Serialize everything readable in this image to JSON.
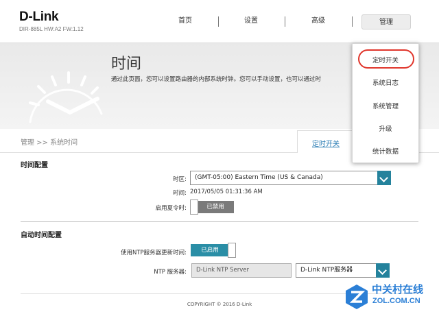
{
  "header": {
    "logo": "D-Link",
    "model": "DIR-885L HW:A2 FW:1.12",
    "nav": [
      {
        "label": "首页"
      },
      {
        "label": "设置"
      },
      {
        "label": "高级"
      },
      {
        "label": "管理"
      }
    ]
  },
  "banner": {
    "title": "时间",
    "description": "通过此页面，您可以设置路由器的内部系统时钟。您可以手动设置，也可以通过时"
  },
  "breadcrumb": "管理 >> 系统时间",
  "tab_link": "定时开关",
  "time_config": {
    "title": "时间配置",
    "timezone_label": "时区:",
    "timezone_value": "(GMT-05:00) Eastern Time (US & Canada)",
    "time_label": "时间:",
    "time_value": "2017/05/05 01:31:36 AM",
    "dst_label": "启用夏令时:",
    "dst_state": "已禁用"
  },
  "auto_time": {
    "title": "自动时间配置",
    "ntp_update_label": "使用NTP服务器更新时间:",
    "ntp_update_state": "已启用",
    "ntp_server_label": "NTP 服务器:",
    "ntp_server_value": "D-Link NTP Server",
    "ntp_server_select": "D-Link NTP服务器"
  },
  "footer": "COPYRIGHT © 2016 D-Link",
  "dropdown": {
    "items": [
      {
        "label": "定时开关"
      },
      {
        "label": "系统日志"
      },
      {
        "label": "系统管理"
      },
      {
        "label": "升级"
      },
      {
        "label": "统计数据"
      }
    ]
  },
  "watermark": {
    "line1": "中关村在线",
    "line2": "ZOL.COM.CN"
  },
  "colors": {
    "accent": "#24829c",
    "enabled": "#2a8ea6",
    "disabled": "#7a7a7a",
    "link": "#2b7db4",
    "highlight": "#e0352b"
  }
}
